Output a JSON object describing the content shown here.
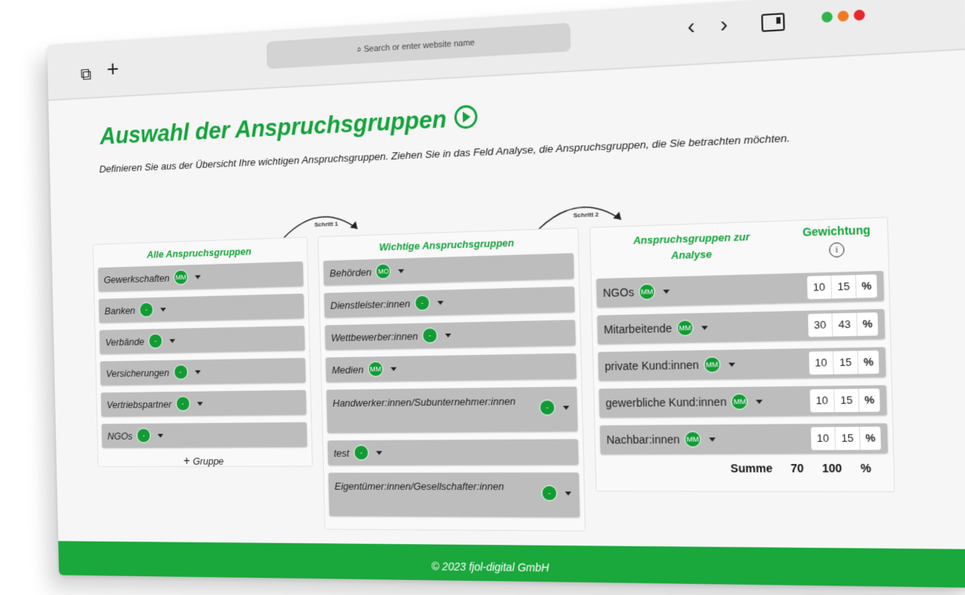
{
  "browser": {
    "url_placeholder": "Search or enter website name",
    "tabs_icon": "tabs-icon",
    "new_tab_icon": "+",
    "back_icon": "‹",
    "forward_icon": "›",
    "window_colors": {
      "green": "#2fb34a",
      "orange": "#f27a22",
      "red": "#e8252b"
    }
  },
  "page": {
    "title": "Auswahl der Anspruchsgruppen",
    "intro": "Definieren Sie aus der Übersicht Ihre wichtigen Anspruchsgruppen. Ziehen Sie in das Feld Analyse, die Anspruchsgruppen, die Sie betrachten möchten.",
    "step1": "Schritt 1",
    "step2": "Schritt 2",
    "accent_color": "#13a33a"
  },
  "columns": {
    "all": {
      "heading": "Alle Anspruchsgruppen",
      "items": [
        {
          "label": "Gewerkschaften",
          "badge": "MM"
        },
        {
          "label": "Banken",
          "badge": "-"
        },
        {
          "label": "Verbände",
          "badge": "-"
        },
        {
          "label": "Versicherungen",
          "badge": "-"
        },
        {
          "label": "Vertriebspartner",
          "badge": "-"
        },
        {
          "label": "NGOs",
          "badge": "-"
        }
      ],
      "add_label": "Gruppe"
    },
    "important": {
      "heading": "Wichtige Anspruchsgruppen",
      "items": [
        {
          "label": "Behörden",
          "badge": "MO"
        },
        {
          "label": "Dienstleister:innen",
          "badge": "-"
        },
        {
          "label": "Wettbewerber:innen",
          "badge": "-"
        },
        {
          "label": "Medien",
          "badge": "MM"
        },
        {
          "label": "Handwerker:innen/Subunternehmer:innen",
          "badge": "-"
        },
        {
          "label": "test",
          "badge": "-"
        },
        {
          "label": "Eigentümer:innen/Gesellschafter:innen",
          "badge": "-"
        }
      ]
    },
    "analysis": {
      "heading": "Anspruchsgruppen zur Analyse",
      "weight_heading": "Gewichtung",
      "items": [
        {
          "label": "NGOs",
          "badge": "MM",
          "value": "10",
          "percent": "15",
          "unit": "%"
        },
        {
          "label": "Mitarbeitende",
          "badge": "MM",
          "value": "30",
          "percent": "43",
          "unit": "%"
        },
        {
          "label": "private Kund:innen",
          "badge": "MM",
          "value": "10",
          "percent": "15",
          "unit": "%"
        },
        {
          "label": "gewerbliche Kund:innen",
          "badge": "MM",
          "value": "10",
          "percent": "15",
          "unit": "%"
        },
        {
          "label": "Nachbar:innen",
          "badge": "MM",
          "value": "10",
          "percent": "15",
          "unit": "%"
        }
      ],
      "sum_label": "Summe",
      "sum_value": "70",
      "sum_percent": "100",
      "sum_unit": "%"
    }
  },
  "footer": {
    "text": "© 2023 fjol-digital GmbH"
  }
}
